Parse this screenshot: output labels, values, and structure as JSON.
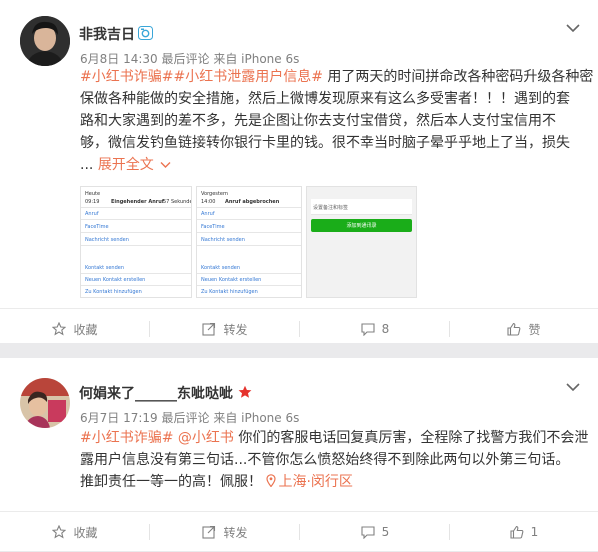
{
  "posts": [
    {
      "username": "非我吉日",
      "verified_badge": "camera-badge-icon",
      "date": "6月8日 14:30",
      "last_comment": "最后评论",
      "source": "来自 iPhone 6s",
      "body": {
        "tag1": "#小红书诈骗#",
        "tag2": "#小红书泄露用户信息#",
        "line1_rest": " 用了两天的时间拼命改各种密码升级各种密",
        "line2": "保做各种能做的安全措施，然后上微博发现原来有这么多受害者！！！遇到的套",
        "line3": "路和大家遇到的差不多，先是企图让你去支付宝借贷，然后本人支付宝信用不",
        "line4": "够，微信发钓鱼链接转你银行卡里的钱。很不幸当时脑子晕乎乎地上了当，损失",
        "line5_start": "... ",
        "expand": "展开全文"
      },
      "thumbnails": [
        {
          "header_left": "Heute",
          "header_time": "09:19",
          "header_title": "Eingehender Anruf",
          "header_extra": "57 Sekunden",
          "rows": [
            "Anruf",
            "FaceTime",
            "Nachricht senden",
            "Kontakt senden",
            "Neuen Kontakt erstellen",
            "Zu Kontakt hinzufügen"
          ]
        },
        {
          "header_left": "Vorgestern",
          "header_time": "14:00",
          "header_title": "Anruf abgebrochen",
          "rows": [
            "Anruf",
            "FaceTime",
            "Nachricht senden",
            "Kontakt senden",
            "Neuen Kontakt erstellen",
            "Zu Kontakt hinzufügen"
          ]
        },
        {
          "field_label": "设置备注和标签",
          "button_label": "添加到通讯录"
        }
      ],
      "actions": {
        "favorite": "收藏",
        "repost": "转发",
        "comments": "8",
        "like": "赞"
      }
    },
    {
      "username_part1": "何娟来了",
      "username_blank": "______",
      "username_part2": "东呲哒呲",
      "date": "6月7日 17:19",
      "last_comment": "最后评论",
      "source": "来自 iPhone 6s",
      "body": {
        "tag1": "#小红书诈骗#",
        "mention": "@小红书",
        "line1_rest": " 你们的客服电话回复真厉害，全程除了找警方我们不会泄",
        "line2": "露用户信息没有第三句话...不管你怎么愤怒始终得不到除此两句以外第三句话。",
        "line3": "推卸责任一等一的高！佩服！",
        "location": "上海·闵行区"
      },
      "actions": {
        "favorite": "收藏",
        "repost": "转发",
        "comments": "5",
        "like": "1"
      }
    }
  ],
  "colors": {
    "accent": "#eb7350",
    "meta": "#808080",
    "link_blue": "#3478d4",
    "wechat_green": "#1aad19"
  }
}
